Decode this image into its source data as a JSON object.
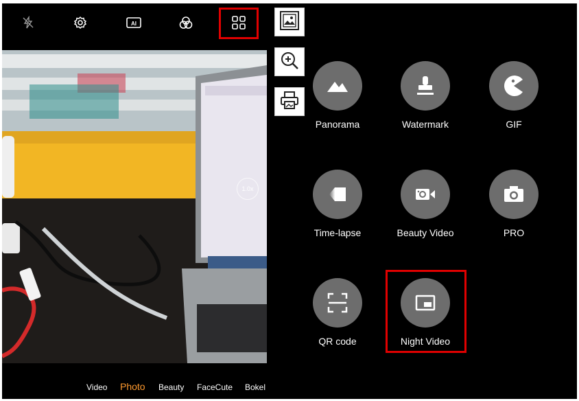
{
  "top_bar": {
    "icons": [
      "flash-off-icon",
      "settings-icon",
      "ai-icon",
      "filter-icon",
      "more-modes-grid-icon"
    ]
  },
  "side_buttons": [
    "image-frame-icon",
    "zoom-in-icon",
    "print-icon"
  ],
  "more_modes": [
    {
      "label": "Panorama",
      "icon": "panorama-icon"
    },
    {
      "label": "Watermark",
      "icon": "watermark-icon"
    },
    {
      "label": "GIF",
      "icon": "gif-icon"
    },
    {
      "label": "Time-lapse",
      "icon": "time-lapse-icon"
    },
    {
      "label": "Beauty Video",
      "icon": "beauty-video-icon"
    },
    {
      "label": "PRO",
      "icon": "pro-camera-icon"
    },
    {
      "label": "QR code",
      "icon": "qr-code-icon"
    },
    {
      "label": "Night Video",
      "icon": "night-video-icon"
    }
  ],
  "mode_bar": {
    "items": [
      "Video",
      "Photo",
      "Beauty",
      "FaceCute",
      "Bokel"
    ],
    "active": "Photo"
  },
  "viewfinder": {
    "zoom_text": "1.0x"
  },
  "colors": {
    "background": "#000000",
    "tile_circle": "#6d6d6d",
    "active_mode": "#ff9a2e",
    "highlight": "#e00000"
  }
}
